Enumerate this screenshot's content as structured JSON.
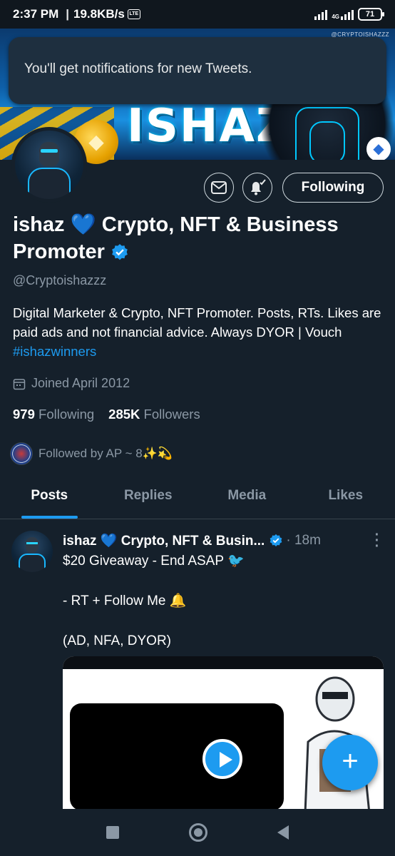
{
  "status_bar": {
    "time": "2:37 PM",
    "separator": "|",
    "speed": "19.8KB/s",
    "lte_icon": "LTE",
    "network_4g": "4G",
    "battery": "71"
  },
  "banner": {
    "brand": "ISHAZ",
    "watermark": "@CRYPTOISHAZZZ"
  },
  "toast": {
    "message": "You'll get notifications for new Tweets."
  },
  "profile": {
    "display_name": "ishaz 💙 Crypto, NFT & Business Promoter",
    "handle": "@Cryptoishazzz",
    "bio_text": "Digital Marketer & Crypto, NFT Promoter. Posts, RTs. Likes are paid ads and not financial advice. Always DYOR | Vouch ",
    "bio_hashtag": "#ishazwinners",
    "joined": "Joined April 2012",
    "following_count": "979",
    "following_label": "Following",
    "followers_count": "285K",
    "followers_label": "Followers",
    "followed_by": "Followed by AP ~ 8✨💫"
  },
  "actions": {
    "follow_label": "Following"
  },
  "tabs": [
    {
      "label": "Posts",
      "active": true
    },
    {
      "label": "Replies",
      "active": false
    },
    {
      "label": "Media",
      "active": false
    },
    {
      "label": "Likes",
      "active": false
    }
  ],
  "tweet": {
    "name": "ishaz 💙 Crypto, NFT & Busin...",
    "time": "· 18m",
    "lines": [
      "$20 Giveaway - End ASAP 🐦",
      "- RT + Follow Me 🔔",
      "(AD, NFA, DYOR)"
    ]
  },
  "fab": {
    "label": "+"
  },
  "colors": {
    "background": "#15202b",
    "accent": "#1d9bf0",
    "muted": "#8b98a5",
    "toast": "#1e2f3f"
  },
  "icons": [
    "message-icon",
    "bell-check-icon",
    "verified-badge-icon",
    "calendar-icon",
    "kebab-menu-icon",
    "play-icon",
    "compose-plus-icon"
  ]
}
